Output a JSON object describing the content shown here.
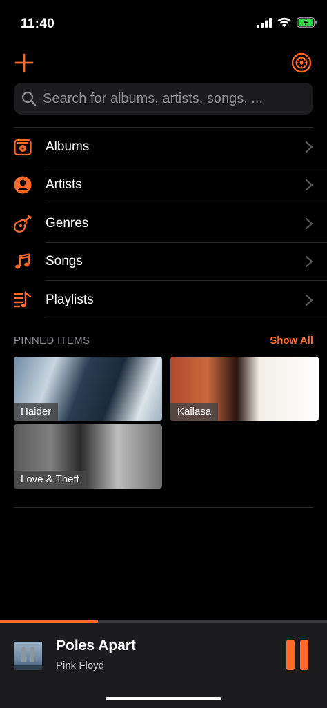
{
  "status": {
    "time": "11:40"
  },
  "search": {
    "placeholder": "Search for albums, artists, songs, ..."
  },
  "menu": {
    "items": [
      {
        "label": "Albums",
        "icon": "albums-icon"
      },
      {
        "label": "Artists",
        "icon": "artist-icon"
      },
      {
        "label": "Genres",
        "icon": "guitar-icon"
      },
      {
        "label": "Songs",
        "icon": "music-note-icon"
      },
      {
        "label": "Playlists",
        "icon": "playlist-icon"
      }
    ]
  },
  "pinned": {
    "title": "PINNED ITEMS",
    "show_all": "Show All",
    "items": [
      {
        "label": "Haider"
      },
      {
        "label": "Kailasa"
      },
      {
        "label": "Love & Theft"
      }
    ]
  },
  "now_playing": {
    "title": "Poles Apart",
    "artist": "Pink Floyd",
    "progress": 0.3
  },
  "colors": {
    "accent": "#ff6a2a",
    "background": "#000000",
    "surface": "#1c1c1e"
  }
}
